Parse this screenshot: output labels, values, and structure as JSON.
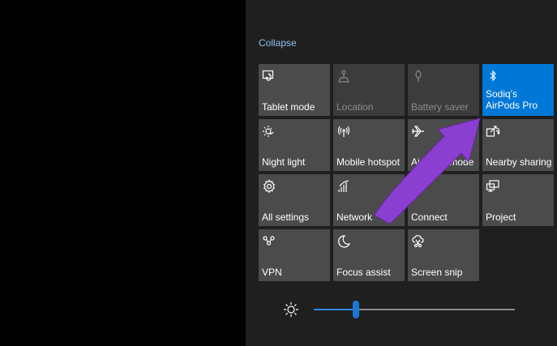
{
  "action_center": {
    "collapse_label": "Collapse",
    "tiles": [
      {
        "label": "Tablet mode",
        "icon": "tablet-mode-icon",
        "state": "off"
      },
      {
        "label": "Location",
        "icon": "location-icon",
        "state": "disabled"
      },
      {
        "label": "Battery saver",
        "icon": "battery-saver-icon",
        "state": "disabled"
      },
      {
        "label": "Sodiq's AirPods Pro",
        "icon": "bluetooth-icon",
        "state": "on"
      },
      {
        "label": "Night light",
        "icon": "night-light-icon",
        "state": "off"
      },
      {
        "label": "Mobile hotspot",
        "icon": "mobile-hotspot-icon",
        "state": "off"
      },
      {
        "label": "Airplane mode",
        "icon": "airplane-icon",
        "state": "off"
      },
      {
        "label": "Nearby sharing",
        "icon": "nearby-sharing-icon",
        "state": "off"
      },
      {
        "label": "All settings",
        "icon": "settings-gear-icon",
        "state": "off"
      },
      {
        "label": "Network",
        "icon": "network-icon",
        "state": "off"
      },
      {
        "label": "Connect",
        "icon": "connect-icon",
        "state": "off"
      },
      {
        "label": "Project",
        "icon": "project-icon",
        "state": "off"
      },
      {
        "label": "VPN",
        "icon": "vpn-icon",
        "state": "off"
      },
      {
        "label": "Focus assist",
        "icon": "moon-icon",
        "state": "off"
      },
      {
        "label": "Screen snip",
        "icon": "screen-snip-icon",
        "state": "off"
      }
    ],
    "brightness": {
      "icon": "sun-icon",
      "level_fraction": 0.21
    }
  },
  "colors": {
    "accent": "#0078d7",
    "annotation_arrow": "#8b3fd0",
    "panel_background": "#1f1f1f",
    "tile_background": "#4b4b4b"
  }
}
